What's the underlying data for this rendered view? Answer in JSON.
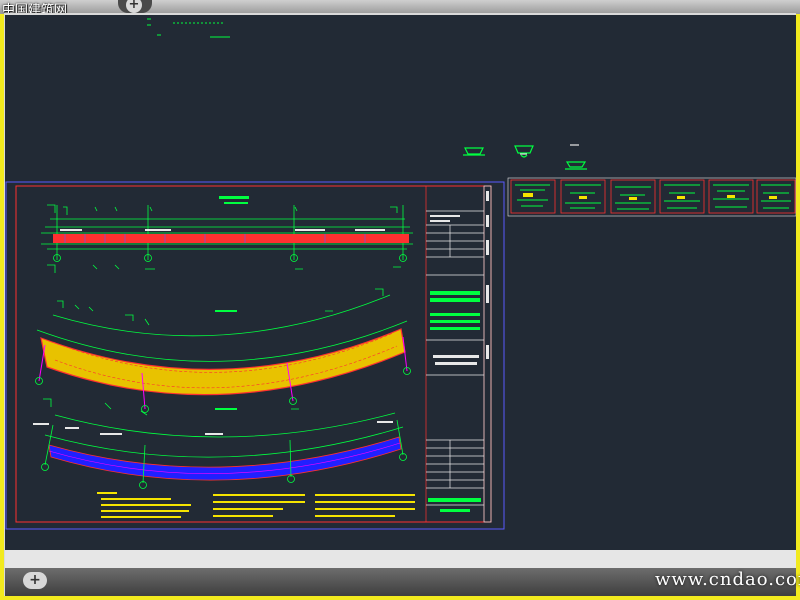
{
  "window": {
    "tab_title": "中国建筑网",
    "new_tab_icon": "plus-icon"
  },
  "layout_bar": {
    "new_layout_icon": "plus-icon"
  },
  "watermark": {
    "text": "www.cndao.com"
  },
  "colors": {
    "canvas_bg": "#222a35",
    "frame_yellow": "#f2ea1e",
    "cad_green": "#00ff40",
    "cad_red": "#ff3030",
    "cad_yellow": "#f5e400",
    "cad_blue": "#2020ff",
    "cad_magenta": "#ff00ff",
    "cad_white": "#e8e8e8"
  }
}
